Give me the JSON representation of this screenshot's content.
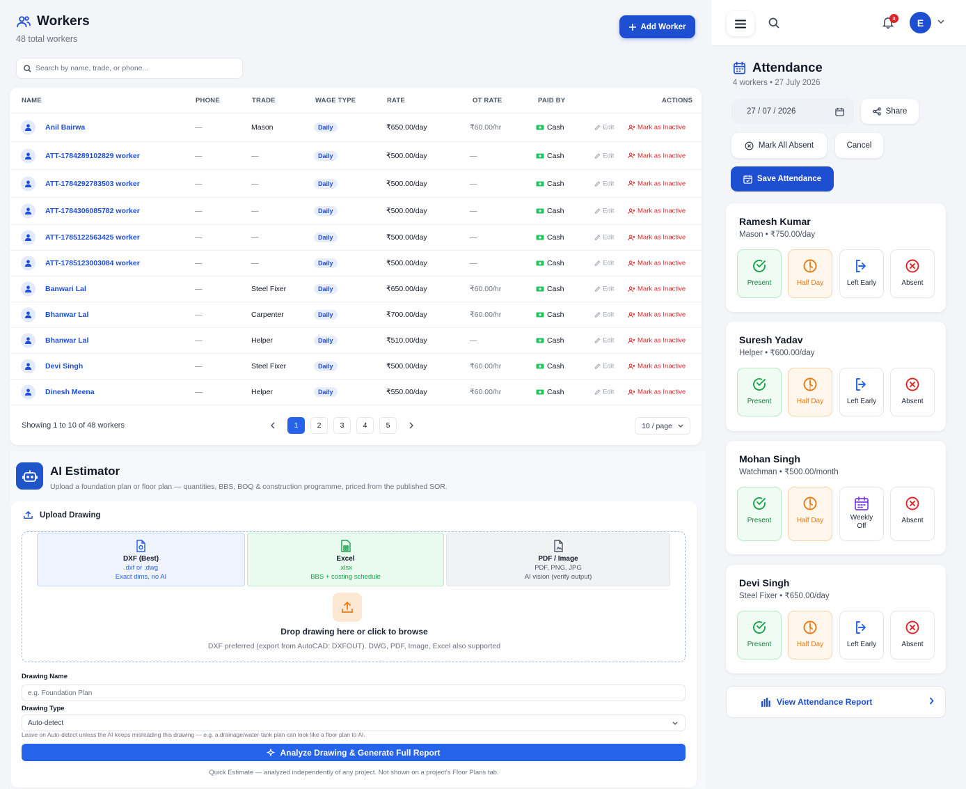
{
  "workers": {
    "title": "Workers",
    "subtitle": "48 total workers",
    "add_button": "Add Worker",
    "search_placeholder": "Search by name, trade, or phone...",
    "columns": [
      "NAME",
      "PHONE",
      "TRADE",
      "WAGE TYPE",
      "RATE",
      "OT RATE",
      "PAID BY",
      "ACTIONS"
    ],
    "rows": [
      {
        "name": "Anil Bairwa",
        "phone": "—",
        "trade": "Mason",
        "wage": "Daily",
        "rate": "₹650.00/day",
        "ot": "₹60.00/hr",
        "paid": "Cash",
        "edit": "Edit",
        "inactive": "Mark as Inactive"
      },
      {
        "name": "ATT-1784289102829 worker",
        "phone": "—",
        "trade": "—",
        "wage": "Daily",
        "rate": "₹500.00/day",
        "ot": "—",
        "paid": "Cash",
        "edit": "Edit",
        "inactive": "Mark as Inactive"
      },
      {
        "name": "ATT-1784292783503 worker",
        "phone": "—",
        "trade": "—",
        "wage": "Daily",
        "rate": "₹500.00/day",
        "ot": "—",
        "paid": "Cash",
        "edit": "Edit",
        "inactive": "Mark as Inactive"
      },
      {
        "name": "ATT-1784306085782 worker",
        "phone": "—",
        "trade": "—",
        "wage": "Daily",
        "rate": "₹500.00/day",
        "ot": "—",
        "paid": "Cash",
        "edit": "Edit",
        "inactive": "Mark as Inactive"
      },
      {
        "name": "ATT-1785122563425 worker",
        "phone": "—",
        "trade": "—",
        "wage": "Daily",
        "rate": "₹500.00/day",
        "ot": "—",
        "paid": "Cash",
        "edit": "Edit",
        "inactive": "Mark as Inactive"
      },
      {
        "name": "ATT-1785123003084 worker",
        "phone": "—",
        "trade": "—",
        "wage": "Daily",
        "rate": "₹500.00/day",
        "ot": "—",
        "paid": "Cash",
        "edit": "Edit",
        "inactive": "Mark as Inactive"
      },
      {
        "name": "Banwari Lal",
        "phone": "—",
        "trade": "Steel Fixer",
        "wage": "Daily",
        "rate": "₹650.00/day",
        "ot": "₹60.00/hr",
        "paid": "Cash",
        "edit": "Edit",
        "inactive": "Mark as Inactive"
      },
      {
        "name": "Bhanwar Lal",
        "phone": "—",
        "trade": "Carpenter",
        "wage": "Daily",
        "rate": "₹700.00/day",
        "ot": "₹60.00/hr",
        "paid": "Cash",
        "edit": "Edit",
        "inactive": "Mark as Inactive"
      },
      {
        "name": "Bhanwar Lal",
        "phone": "—",
        "trade": "Helper",
        "wage": "Daily",
        "rate": "₹510.00/day",
        "ot": "—",
        "paid": "Cash",
        "edit": "Edit",
        "inactive": "Mark as Inactive"
      },
      {
        "name": "Devi Singh",
        "phone": "—",
        "trade": "Steel Fixer",
        "wage": "Daily",
        "rate": "₹500.00/day",
        "ot": "₹60.00/hr",
        "paid": "Cash",
        "edit": "Edit",
        "inactive": "Mark as Inactive"
      },
      {
        "name": "Dinesh Meena",
        "phone": "—",
        "trade": "Helper",
        "wage": "Daily",
        "rate": "₹550.00/day",
        "ot": "₹60.00/hr",
        "paid": "Cash",
        "edit": "Edit",
        "inactive": "Mark as Inactive"
      }
    ],
    "footer": "Showing 1 to 10 of 48 workers",
    "pages": [
      "1",
      "2",
      "3",
      "4",
      "5"
    ],
    "current_page": "1",
    "per_page": "10 / page"
  },
  "estimator": {
    "title": "AI Estimator",
    "subtitle": "Upload a foundation plan or floor plan — quantities, BBS, BOQ & construction programme, priced from the published SOR.",
    "upload_heading": "Upload Drawing",
    "options": [
      {
        "title": "DXF (Best)",
        "line1": ".dxf or .dwg",
        "line2": "Exact dims, no AI"
      },
      {
        "title": "Excel",
        "line1": ".xlsx",
        "line2": "BBS + costing schedule"
      },
      {
        "title": "PDF / Image",
        "line1": "PDF, PNG, JPG",
        "line2": "AI vision (verify output)"
      }
    ],
    "drop_main": "Drop drawing here or click to browse",
    "drop_sub": "DXF preferred (export from AutoCAD: DXFOUT). DWG, PDF, Image, Excel also supported",
    "drawing_name_label": "Drawing Name",
    "drawing_name_placeholder": "e.g. Foundation Plan",
    "drawing_type_label": "Drawing Type",
    "drawing_type_value": "Auto-detect",
    "hint": "Leave on Auto-detect unless the AI keeps misreading this drawing — e.g. a drainage/water-tank plan can look like a floor plan to AI.",
    "analyze_button": "Analyze Drawing & Generate Full Report",
    "quick_note": "Quick Estimate — analyzed independently of any project. Not shown on a project's Floor Plans tab."
  },
  "topbar": {
    "notification_count": "3",
    "user_initial": "E"
  },
  "attendance": {
    "title": "Attendance",
    "subtitle": "4 workers • 27 July 2026",
    "date": "27 / 07 / 2026",
    "share": "Share",
    "mark_all_absent": "Mark All Absent",
    "cancel": "Cancel",
    "save": "Save Attendance",
    "workers": [
      {
        "name": "Ramesh Kumar",
        "sub": "Mason • ₹750.00/day",
        "third": "Left Early"
      },
      {
        "name": "Suresh Yadav",
        "sub": "Helper • ₹600.00/day",
        "third": "Left Early"
      },
      {
        "name": "Mohan Singh",
        "sub": "Watchman • ₹500.00/month",
        "third": "Weekly Off"
      },
      {
        "name": "Devi Singh",
        "sub": "Steel Fixer • ₹650.00/day",
        "third": "Left Early"
      }
    ],
    "status_present": "Present",
    "status_half": "Half Day",
    "status_absent": "Absent",
    "report_link": "View Attendance Report"
  },
  "colors": {
    "primary": "#1e4fd0",
    "accent": "#2563eb",
    "danger": "#dc2626",
    "success": "#15803d",
    "warning": "#ea7a14"
  }
}
